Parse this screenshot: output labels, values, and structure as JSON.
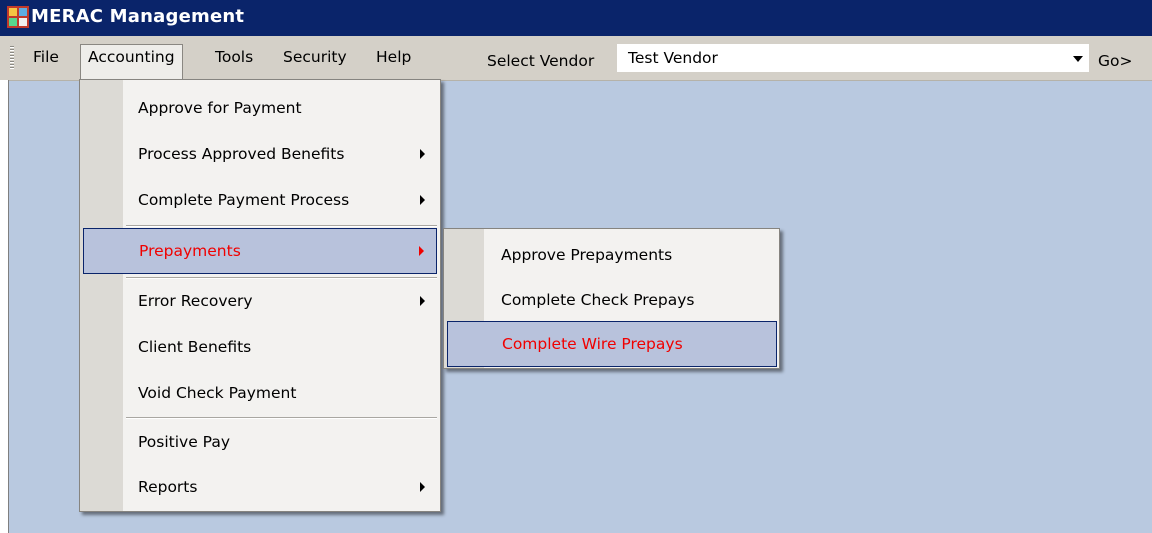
{
  "window": {
    "title": "MERAC Management",
    "background": "#b9c9e0",
    "titlebar_color": "#0a246a"
  },
  "menubar": {
    "items": [
      "File",
      "Accounting",
      "Tools",
      "Security",
      "Help"
    ],
    "file_label": "File",
    "accounting_label": "Accounting",
    "tools_label": "Tools",
    "security_label": "Security",
    "help_label": "Help",
    "open_menu": "Accounting"
  },
  "vendor": {
    "label": "Select Vendor",
    "selected": "Test Vendor",
    "go_label": "Go>"
  },
  "accounting_menu": {
    "items": [
      {
        "label": "Approve for Payment",
        "submenu": false
      },
      {
        "label": "Process Approved Benefits",
        "submenu": true
      },
      {
        "label": "Complete Payment Process",
        "submenu": true
      },
      {
        "label": "Prepayments",
        "submenu": true,
        "highlighted": true
      },
      {
        "label": "Error Recovery",
        "submenu": true
      },
      {
        "label": "Client Benefits",
        "submenu": false
      },
      {
        "label": "Void Check Payment",
        "submenu": false
      },
      {
        "label": "Positive Pay",
        "submenu": false
      },
      {
        "label": "Reports",
        "submenu": true
      }
    ]
  },
  "prepayments_menu": {
    "items": [
      {
        "label": "Approve Prepayments",
        "highlighted": false
      },
      {
        "label": "Complete Check Prepays",
        "highlighted": false
      },
      {
        "label": "Complete Wire Prepays",
        "highlighted": true
      }
    ]
  },
  "colors": {
    "highlight_bg": "#b8c2dc",
    "highlight_text": "#f00000",
    "menu_bg": "#f3f2f0"
  }
}
